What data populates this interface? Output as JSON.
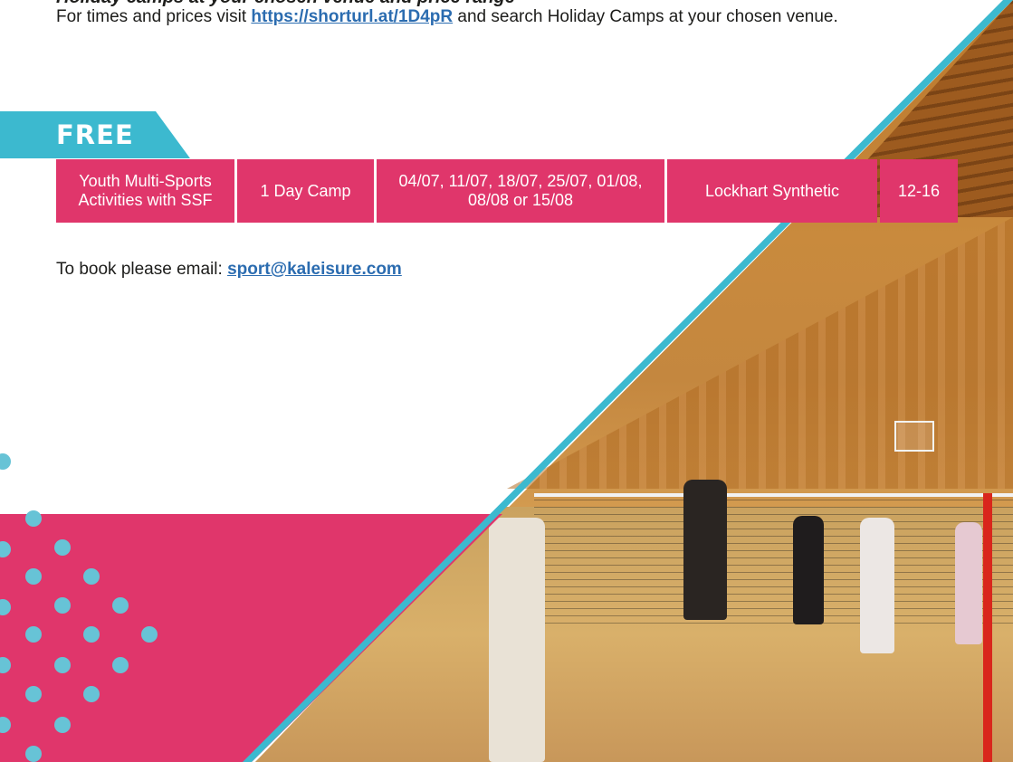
{
  "header": {
    "cutoff_heading": "Holiday camps at your chosen venue and price range",
    "intro_prefix": "For times and prices visit ",
    "intro_link": "https://shorturl.at/1D4pR",
    "intro_suffix": " and search Holiday Camps at your chosen venue."
  },
  "badge": {
    "label": "FREE",
    "color": "#3cb9cf"
  },
  "camp": {
    "activity": "Youth Multi-Sports Activities with SSF",
    "duration": "1 Day Camp",
    "dates": "04/07, 11/07, 18/07, 25/07, 01/08, 08/08 or 15/08",
    "venue": "Lockhart Synthetic",
    "ages": "12-16",
    "cell_color": "#e0366b"
  },
  "booking": {
    "prefix": "To book please email: ",
    "email": "sport@kaleisure.com"
  },
  "colors": {
    "accent_pink": "#e0366b",
    "accent_teal": "#3cb9cf",
    "link": "#2b6cb0"
  }
}
